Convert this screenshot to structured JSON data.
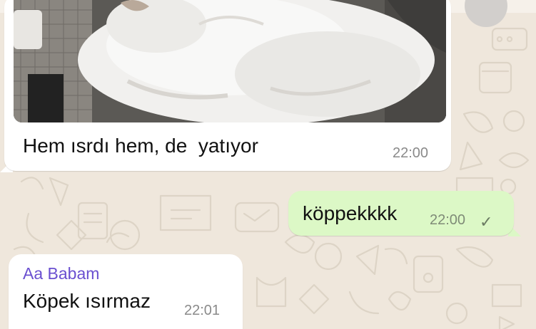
{
  "chat": {
    "messages": [
      {
        "direction": "incoming",
        "attachment": "photo of a white fluffy cat",
        "text": "Hem ısrdı hem, de  yatıyor",
        "time": "22:00"
      },
      {
        "direction": "outgoing",
        "text": "köppekkkk",
        "time": "22:00",
        "status_icon": "check-icon"
      },
      {
        "direction": "incoming",
        "sender": "Aa Babam",
        "text": "Köpek ısırmaz",
        "time": "22:01"
      }
    ]
  },
  "colors": {
    "wallpaper": "#efe7dc",
    "incoming_bubble": "#ffffff",
    "outgoing_bubble": "#dcf8c6",
    "sender_name": "#6a4fd0",
    "timestamp": "#8a8a8a"
  }
}
